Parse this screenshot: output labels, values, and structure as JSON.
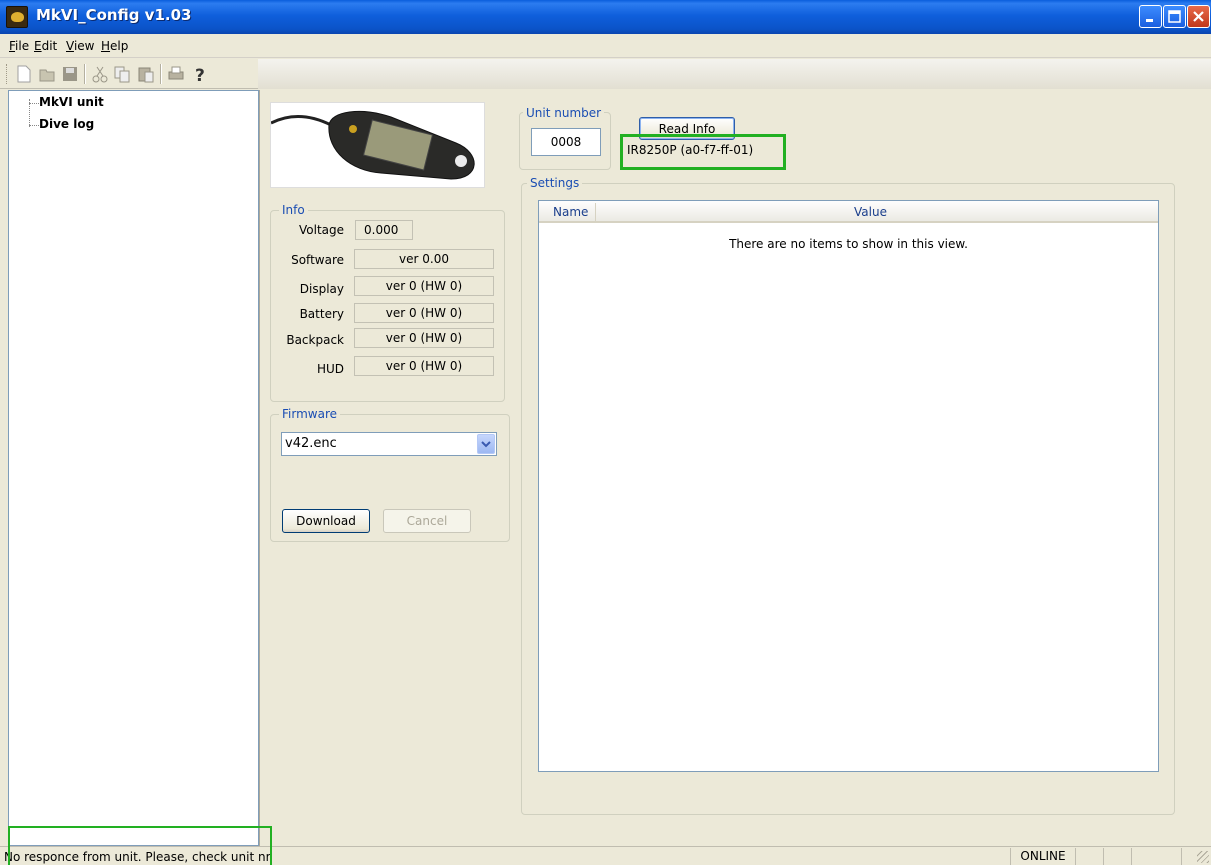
{
  "window": {
    "title": "MkVI_Config v1.03"
  },
  "menu": {
    "items": [
      {
        "label": "File",
        "accel": "F"
      },
      {
        "label": "Edit",
        "accel": "E"
      },
      {
        "label": "View",
        "accel": "V"
      },
      {
        "label": "Help",
        "accel": "H"
      }
    ]
  },
  "toolbar": {
    "buttons": [
      "new-icon",
      "open-icon",
      "save-icon",
      "cut-icon",
      "copy-icon",
      "paste-icon",
      "print-icon",
      "help-icon"
    ]
  },
  "tree": {
    "items": [
      "MkVI unit",
      "Dive log"
    ]
  },
  "info": {
    "title": "Info",
    "voltage_label": "Voltage",
    "voltage_value": "0.000",
    "software_label": "Software",
    "software_value": "ver 0.00",
    "display_label": "Display",
    "display_value": "ver 0 (HW 0)",
    "battery_label": "Battery",
    "battery_value": "ver 0 (HW 0)",
    "backpack_label": "Backpack",
    "backpack_value": "ver 0 (HW 0)",
    "hud_label": "HUD",
    "hud_value": "ver 0 (HW 0)"
  },
  "firmware": {
    "title": "Firmware",
    "selected": "v42.enc",
    "download_label": "Download",
    "cancel_label": "Cancel"
  },
  "unit": {
    "title": "Unit number",
    "value": "0008",
    "read_info_label": "Read Info",
    "chip_id": "IR8250P (a0-f7-ff-01)"
  },
  "settings": {
    "title": "Settings",
    "col_name": "Name",
    "col_value": "Value",
    "empty_text": "There are no items to show in this view."
  },
  "status": {
    "message": "No responce from unit. Please, check unit nr.",
    "connection": "ONLINE"
  },
  "colors": {
    "highlight": "#22b022",
    "title_bar": "#0a5ddc",
    "group_title": "#1a4db3"
  }
}
